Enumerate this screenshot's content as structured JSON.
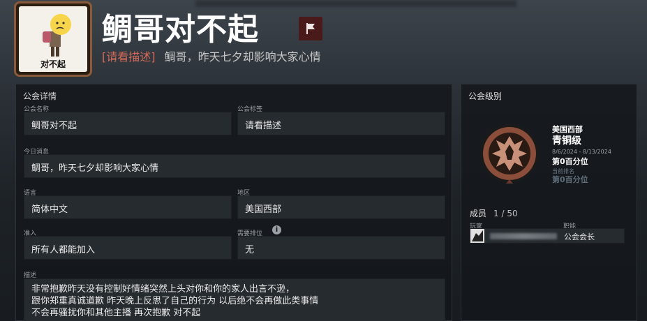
{
  "header": {
    "emblem_text": "对不起",
    "guild_name": "鲷哥对不起",
    "tag": "请看描述",
    "tagline": "鲷哥，昨天七夕却影响大家心情"
  },
  "details": {
    "title": "公会详情",
    "name_label": "公会名称",
    "name_value": "鲷哥对不起",
    "tag_label": "公会标签",
    "tag_value": "请看描述",
    "motd_label": "今日消息",
    "motd_value": "鲷哥，昨天七夕却影响大家心情",
    "lang_label": "语言",
    "lang_value": "简体中文",
    "region_label": "地区",
    "region_value": "美国西部",
    "join_label": "准入",
    "join_value": "所有人都能加入",
    "rank_label": "需要排位",
    "rank_value": "无",
    "desc_label": "描述",
    "desc_lines": [
      "非常抱歉昨天没有控制好情绪突然上头对你和你的家人出言不逊，",
      "跟你郑重真诚道歉 昨天晚上反思了自己的行为 以后绝不会再做此类事情",
      "不会再骚扰你和其他主播 再次抱歉 对不起"
    ]
  },
  "level": {
    "title": "公会级别",
    "region": "美国西部",
    "tier": "青铜级",
    "date_range": "8/6/2024 - 8/13/2024",
    "percentile": "第0百分位",
    "prev_label": "当前排名",
    "prev_percentile": "第0百分位",
    "members_label": "成员",
    "members_count": "1 / 50",
    "col_player": "玩家",
    "col_role": "职能",
    "member_role": "公会会长"
  },
  "colors": {
    "tag_red": "#d46a5a",
    "flag_bg": "#4a1a1a",
    "panel_bg": "#14181c",
    "field_bg": "#262b30"
  },
  "icons": {
    "report": "flag-icon",
    "info": "info-icon",
    "rank_badge": "bronze-badge-icon"
  }
}
